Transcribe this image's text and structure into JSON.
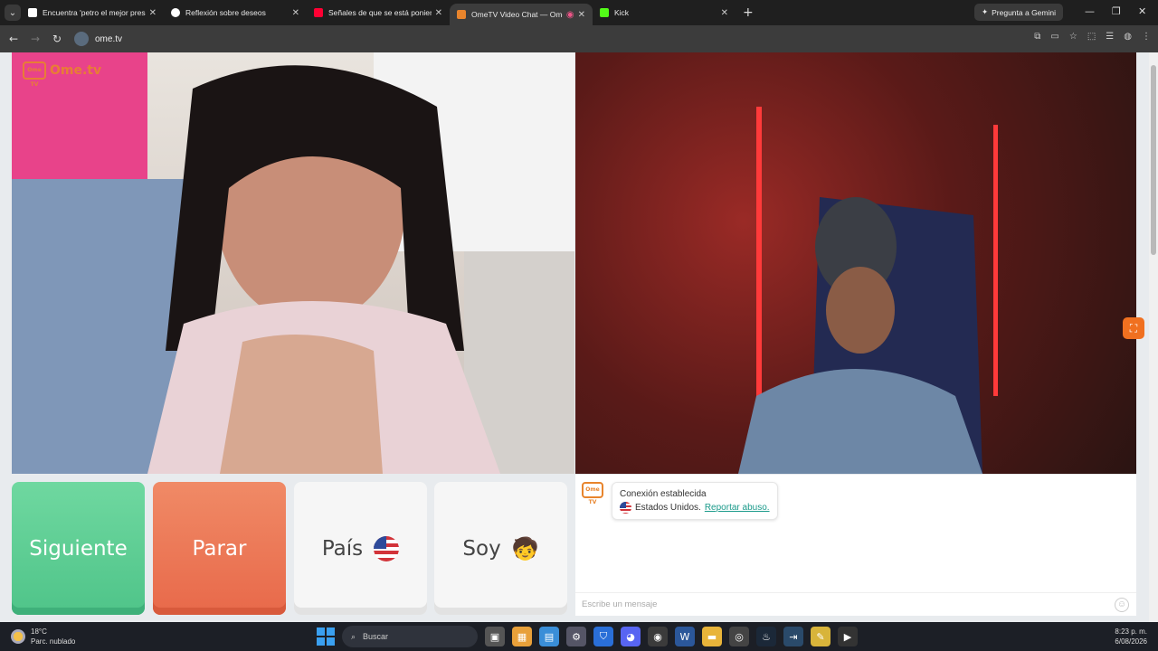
{
  "browser": {
    "tabs": [
      {
        "title": "Encuentra 'petro el mejor presi",
        "fav_color": "#ffffff",
        "active": false
      },
      {
        "title": "Reflexión sobre deseos",
        "fav_color": "#ffffff",
        "active": false
      },
      {
        "title": "Señales de que se está ponienc",
        "fav_color": "#ff0033",
        "active": false
      },
      {
        "title": "OmeTV Video Chat — Ome",
        "fav_color": "#e8842c",
        "active": true
      },
      {
        "title": "Kick",
        "fav_color": "#53fc18",
        "active": false
      }
    ],
    "new_tab": "+",
    "gemini_label": "Pregunta a Gemini",
    "url": "ome.tv"
  },
  "page": {
    "logo_text": "Ome.tv",
    "logo_box": "Ome TV",
    "buttons": {
      "next": "Siguiente",
      "stop": "Parar",
      "country": "País",
      "gender": "Soy",
      "gender_emoji": "🧒"
    },
    "chat": {
      "logo": "Ome TV",
      "connection": "Conexión establecida",
      "country": "Estados Unidos.",
      "report": "Reportar abuso.",
      "input_placeholder": "Escribe un mensaje",
      "emoji_icon": "☺"
    }
  },
  "taskbar": {
    "temperature": "18°C",
    "weather": "Parc. nublado",
    "search_label": "Buscar",
    "time": "8:23 p. m.",
    "date": "6/08/2026"
  },
  "colors": {
    "next": "#4fc489",
    "stop": "#e8694a",
    "brand": "#e8842c"
  }
}
